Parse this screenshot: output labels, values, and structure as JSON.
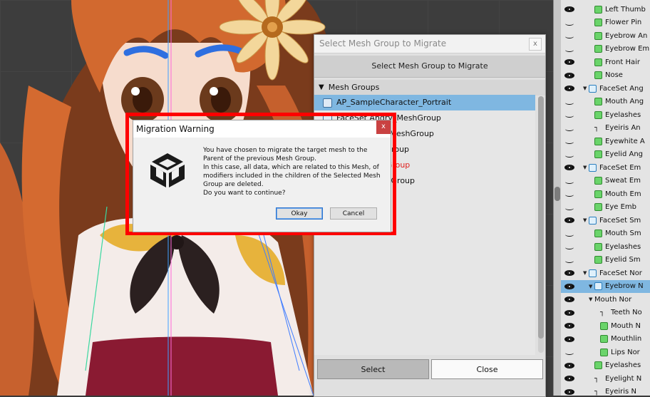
{
  "migrate_dialog": {
    "window_title": "Select Mesh Group to Migrate",
    "close_label": "x",
    "header": "Select Mesh Group to Migrate",
    "groups_header": "Mesh Groups",
    "items": [
      {
        "label": "AP_SampleCharacter_Portrait",
        "selected": true,
        "red": false
      },
      {
        "label": "FaceSet Angry_MeshGroup",
        "selected": false,
        "red": false
      },
      {
        "label": "...mbarrassd_MeshGroup",
        "selected": false,
        "red": false
      },
      {
        "label": "...mile_MeshGroup",
        "selected": false,
        "red": false
      },
      {
        "label": "...rmal_MeshGroup",
        "selected": false,
        "red": true
      },
      {
        "label": "...ormal_MeshGroup",
        "selected": false,
        "red": false
      }
    ],
    "select_label": "Select",
    "close_button_label": "Close"
  },
  "warning": {
    "title": "Migration Warning",
    "close_label": "x",
    "message": "You have chosen to migrate the target mesh to the\nParent of the previous Mesh Group.\nIn this case, all data, which are related to this Mesh, of\nmodifiers included in the children of the Selected Mesh\nGroup are deleted.\nDo you want to continue?",
    "ok_label": "Okay",
    "cancel_label": "Cancel"
  },
  "hierarchy": {
    "rows": [
      {
        "label": "Left Thumb",
        "eye": "open",
        "icon": "mesh",
        "indent": 2,
        "arrow": ""
      },
      {
        "label": "Flower Pin",
        "eye": "closed",
        "icon": "mesh",
        "indent": 2,
        "arrow": ""
      },
      {
        "label": "Eyebrow An",
        "eye": "closed",
        "icon": "mesh",
        "indent": 2,
        "arrow": ""
      },
      {
        "label": "Eyebrow Em",
        "eye": "closed",
        "icon": "mesh",
        "indent": 2,
        "arrow": ""
      },
      {
        "label": "Front Hair",
        "eye": "open",
        "icon": "mesh",
        "indent": 2,
        "arrow": ""
      },
      {
        "label": "Nose",
        "eye": "open",
        "icon": "mesh",
        "indent": 2,
        "arrow": ""
      },
      {
        "label": "FaceSet Ang",
        "eye": "open",
        "icon": "group",
        "indent": 1,
        "arrow": "▼"
      },
      {
        "label": "Mouth Ang",
        "eye": "closed",
        "icon": "mesh",
        "indent": 2,
        "arrow": ""
      },
      {
        "label": "Eyelashes",
        "eye": "closed",
        "icon": "mesh",
        "indent": 2,
        "arrow": ""
      },
      {
        "label": "Eyeiris An",
        "eye": "closed",
        "icon": "bone",
        "indent": 2,
        "arrow": ""
      },
      {
        "label": "Eyewhite A",
        "eye": "closed",
        "icon": "mesh",
        "indent": 2,
        "arrow": ""
      },
      {
        "label": "Eyelid Ang",
        "eye": "closed",
        "icon": "mesh",
        "indent": 2,
        "arrow": ""
      },
      {
        "label": "FaceSet Em",
        "eye": "open",
        "icon": "group",
        "indent": 1,
        "arrow": "▼"
      },
      {
        "label": "Sweat Em",
        "eye": "closed",
        "icon": "mesh",
        "indent": 2,
        "arrow": ""
      },
      {
        "label": "Mouth Em",
        "eye": "closed",
        "icon": "mesh",
        "indent": 2,
        "arrow": ""
      },
      {
        "label": "Eye Emb",
        "eye": "closed",
        "icon": "mesh",
        "indent": 2,
        "arrow": ""
      },
      {
        "label": "FaceSet Sm",
        "eye": "open",
        "icon": "group",
        "indent": 1,
        "arrow": "▼"
      },
      {
        "label": "Mouth Sm",
        "eye": "closed",
        "icon": "mesh",
        "indent": 2,
        "arrow": ""
      },
      {
        "label": "Eyelashes",
        "eye": "closed",
        "icon": "mesh",
        "indent": 2,
        "arrow": ""
      },
      {
        "label": "Eyelid Sm",
        "eye": "closed",
        "icon": "mesh",
        "indent": 2,
        "arrow": ""
      },
      {
        "label": "FaceSet Nor",
        "eye": "open",
        "icon": "group",
        "indent": 1,
        "arrow": "▼"
      },
      {
        "label": "Eyebrow N",
        "eye": "open",
        "icon": "group",
        "indent": 2,
        "arrow": "▼",
        "selected": true
      },
      {
        "label": "Mouth Nor",
        "eye": "open",
        "icon": "",
        "indent": 2,
        "arrow": "▼"
      },
      {
        "label": "Teeth No",
        "eye": "open",
        "icon": "bone",
        "indent": 3,
        "arrow": ""
      },
      {
        "label": "Mouth N",
        "eye": "open",
        "icon": "mesh",
        "indent": 3,
        "arrow": ""
      },
      {
        "label": "Mouthlin",
        "eye": "open",
        "icon": "mesh",
        "indent": 3,
        "arrow": ""
      },
      {
        "label": "Lips Nor",
        "eye": "closed",
        "icon": "mesh",
        "indent": 3,
        "arrow": ""
      },
      {
        "label": "Eyelashes",
        "eye": "open",
        "icon": "mesh",
        "indent": 2,
        "arrow": ""
      },
      {
        "label": "Eyelight N",
        "eye": "open",
        "icon": "bone",
        "indent": 2,
        "arrow": ""
      },
      {
        "label": "Eyeiris N",
        "eye": "open",
        "icon": "bone",
        "indent": 2,
        "arrow": ""
      }
    ]
  }
}
